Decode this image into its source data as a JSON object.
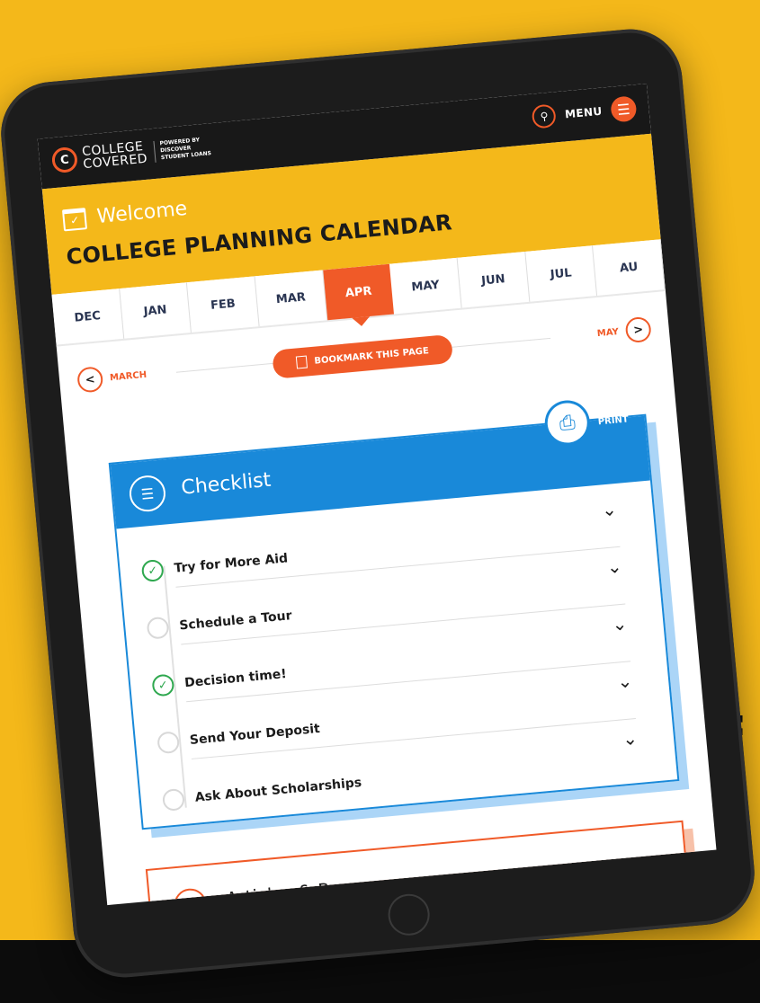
{
  "app": {
    "logo_line1": "COLLEGE",
    "logo_line2": "COVERED",
    "powered_by_1": "POWERED BY",
    "powered_by_2": "DISCOVER",
    "powered_by_3": "STUDENT LOANS",
    "menu_label": "MENU"
  },
  "header": {
    "welcome": "Welcome",
    "title": "COLLEGE PLANNING CALENDAR"
  },
  "months": [
    {
      "label": "DEC",
      "active": false
    },
    {
      "label": "JAN",
      "active": false
    },
    {
      "label": "FEB",
      "active": false
    },
    {
      "label": "MAR",
      "active": false
    },
    {
      "label": "APR",
      "active": true
    },
    {
      "label": "MAY",
      "active": false
    },
    {
      "label": "JUN",
      "active": false
    },
    {
      "label": "JUL",
      "active": false
    },
    {
      "label": "AU",
      "active": false
    }
  ],
  "navigation": {
    "prev_label": "MARCH",
    "next_label": "MAY",
    "prev_symbol": "<",
    "next_symbol": ">",
    "bookmark_label": "BOOKMARK THIS PAGE"
  },
  "checklist": {
    "title": "Checklist",
    "print_label": "PRINT",
    "items": [
      {
        "label": "Try for More Aid",
        "done": true
      },
      {
        "label": "Schedule a Tour",
        "done": false
      },
      {
        "label": "Decision time!",
        "done": true
      },
      {
        "label": "Send Your Deposit",
        "done": false
      },
      {
        "label": "Ask About Scholarships",
        "done": false
      }
    ]
  },
  "articles": {
    "title": "Articles & Resources"
  },
  "colors": {
    "brand_orange": "#f05a28",
    "header_yellow": "#f4b81a",
    "checklist_blue": "#1989d9",
    "check_green": "#2fa84f"
  }
}
